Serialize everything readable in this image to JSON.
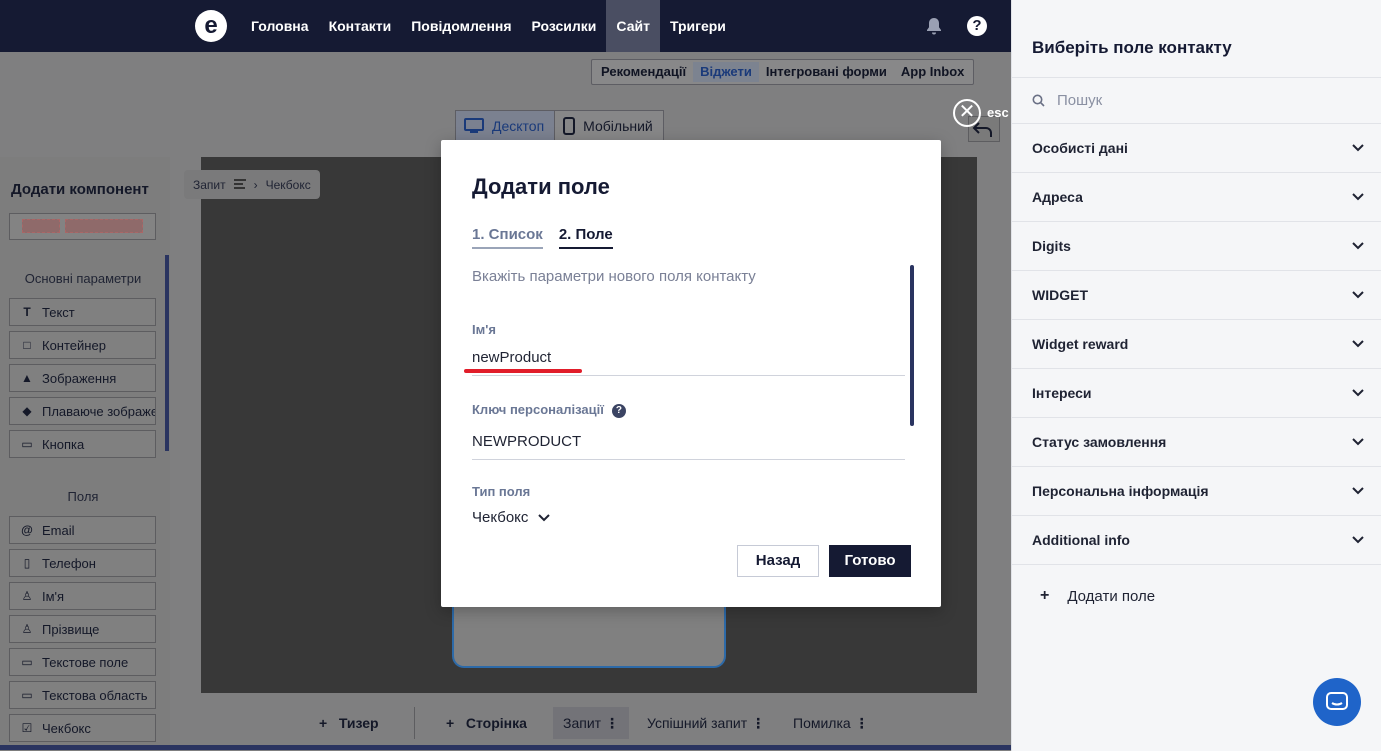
{
  "topbar": {
    "logo": "e",
    "nav": [
      "Головна",
      "Контакти",
      "Повідомлення",
      "Розсилки",
      "Сайт",
      "Тригери"
    ],
    "active_nav": "Сайт",
    "help": "?"
  },
  "subnav": {
    "tabs": [
      "Рекомендації",
      "Віджети",
      "Інтегровані форми",
      "App Inbox"
    ],
    "active": "Віджети"
  },
  "device_tabs": {
    "desktop": "Десктоп",
    "mobile": "Мобільний"
  },
  "close": {
    "icon": "✕",
    "label": "esc"
  },
  "left_panel": {
    "title": "Додати компонент",
    "section_main": "Основні параметри",
    "main_items": [
      {
        "label": "Текст",
        "icon": "T"
      },
      {
        "label": "Контейнер",
        "icon": "□"
      },
      {
        "label": "Зображення",
        "icon": "▲"
      },
      {
        "label": "Плаваюче зображення",
        "icon": "◆"
      },
      {
        "label": "Кнопка",
        "icon": "▭"
      }
    ],
    "section_fields": "Поля",
    "field_items": [
      {
        "label": "Email",
        "icon": "@"
      },
      {
        "label": "Телефон",
        "icon": "▯"
      },
      {
        "label": "Ім'я",
        "icon": "♙"
      },
      {
        "label": "Прізвище",
        "icon": "♙"
      },
      {
        "label": "Текстове поле",
        "icon": "▭"
      },
      {
        "label": "Текстова область",
        "icon": "▭"
      },
      {
        "label": "Чекбокс",
        "icon": "☑"
      }
    ]
  },
  "breadcrumb": {
    "first": "Запит",
    "sep": "›",
    "second": "Чекбокс"
  },
  "bottom_bar": {
    "teaser": "Тизер",
    "page": "Сторінка",
    "request": "Запит",
    "success": "Успішний запит",
    "error": "Помилка"
  },
  "modal": {
    "title": "Додати поле",
    "step1": "1. Список",
    "step2": "2. Поле",
    "subtitle": "Вкажіть параметри нового поля контакту",
    "name_label": "Ім'я",
    "name_value": "newProduct",
    "key_label": "Ключ персоналізації",
    "key_help": "?",
    "key_value": "NEWPRODUCT",
    "type_label": "Тип поля",
    "type_value": "Чекбокс",
    "back": "Назад",
    "done": "Готово"
  },
  "right_panel": {
    "title": "Виберіть поле контакту",
    "search_placeholder": "Пошук",
    "groups": [
      "Особисті дані",
      "Адреса",
      "Digits",
      "WIDGET",
      "Widget reward",
      "Інтереси",
      "Статус замовлення",
      "Персональна інформація",
      "Additional info"
    ],
    "add_field": "Додати поле",
    "add_icon": "+"
  },
  "colors": {
    "navy": "#151a33",
    "accent": "#1f64c9",
    "red": "#e11d2a"
  }
}
